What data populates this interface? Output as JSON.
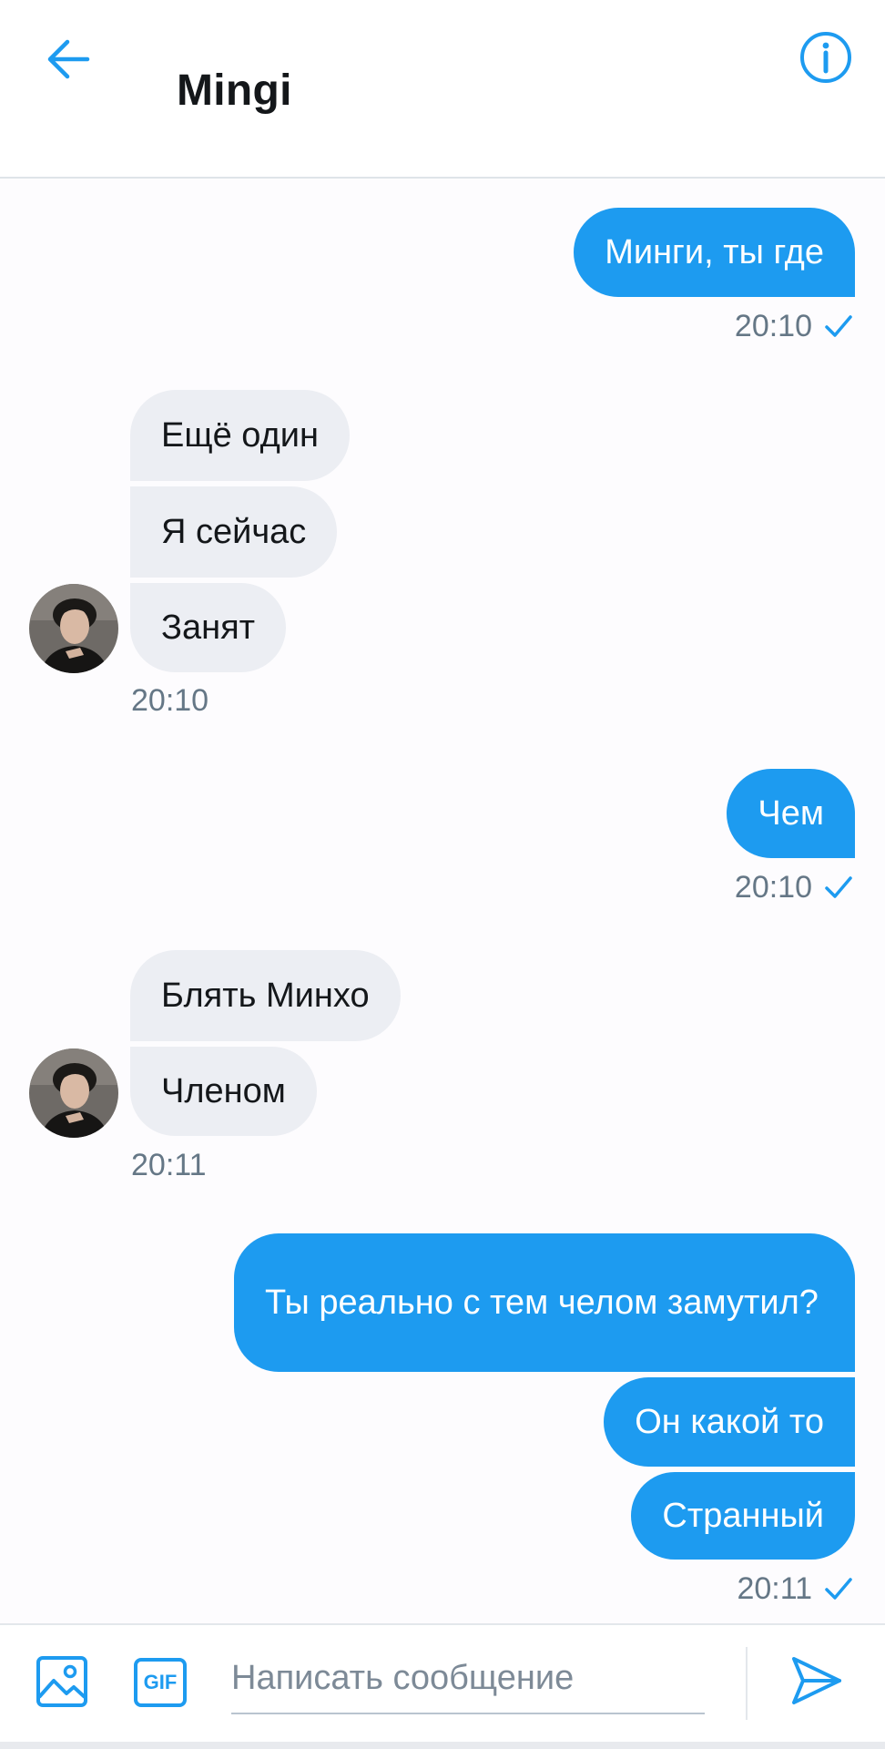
{
  "header": {
    "title": "Mingi",
    "back_icon": "arrow-left-icon",
    "info_icon": "info-icon"
  },
  "accent_color": "#1d9bf0",
  "messages": [
    {
      "direction": "out",
      "text": "Минги, ты где"
    },
    {
      "direction": "out_time",
      "time": "20:10",
      "status_icon": "check-icon"
    },
    {
      "direction": "in",
      "text": "Ещё один"
    },
    {
      "direction": "in",
      "text": "Я сейчас"
    },
    {
      "direction": "in",
      "text": "Занят"
    },
    {
      "direction": "in_time",
      "time": "20:10"
    },
    {
      "direction": "out",
      "text": "Чем"
    },
    {
      "direction": "out_time",
      "time": "20:10",
      "status_icon": "check-icon"
    },
    {
      "direction": "in",
      "text": "Блять Минхо"
    },
    {
      "direction": "in",
      "text": "Членом"
    },
    {
      "direction": "in_time",
      "time": "20:11"
    },
    {
      "direction": "out",
      "text": "Ты реально с тем челом замутил?"
    },
    {
      "direction": "out",
      "text": "Он какой то"
    },
    {
      "direction": "out",
      "text": "Странный"
    },
    {
      "direction": "out_time",
      "time": "20:11",
      "status_icon": "check-icon"
    }
  ],
  "composer": {
    "placeholder": "Написать сообщение",
    "media_icon": "image-icon",
    "gif_label": "GIF",
    "send_icon": "send-icon"
  }
}
